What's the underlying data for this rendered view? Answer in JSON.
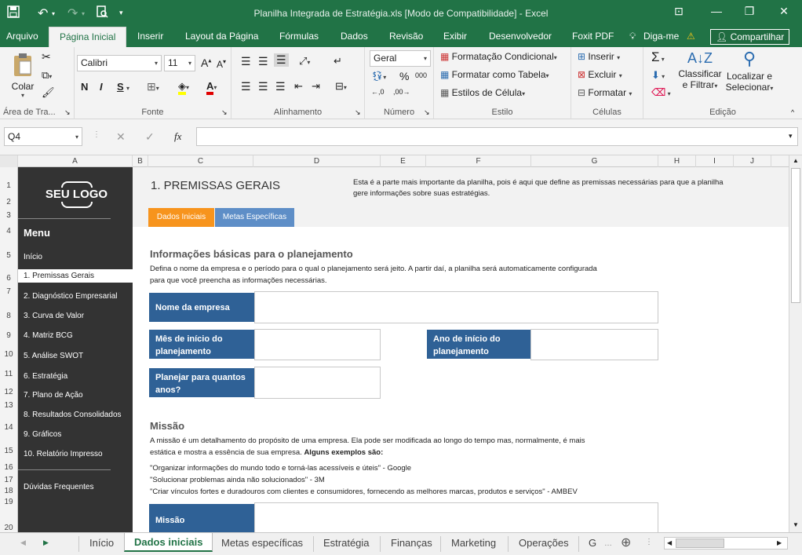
{
  "window": {
    "title": "Planilha Integrada de Estratégia.xls  [Modo de Compatibilidade] - Excel"
  },
  "ribbon_tabs": [
    "Arquivo",
    "Página Inicial",
    "Inserir",
    "Layout da Página",
    "Fórmulas",
    "Dados",
    "Revisão",
    "Exibir",
    "Desenvolvedor",
    "Foxit PDF",
    "Diga-me",
    "Compartilhar"
  ],
  "ribbon": {
    "colar": "Colar",
    "area_transferencia": "Área de Tra...",
    "font_name": "Calibri",
    "font_size": "11",
    "fonte": "Fonte",
    "bold": "N",
    "italic": "I",
    "underline": "S",
    "alinhamento": "Alinhamento",
    "number_format": "Geral",
    "numero": "Número",
    "formatacao_condicional": "Formatação Condicional",
    "formatar_tabela": "Formatar como Tabela",
    "estilos_celula": "Estilos de Célula",
    "estilo": "Estilo",
    "inserir": "Inserir",
    "excluir": "Excluir",
    "formatar": "Formatar",
    "celulas": "Células",
    "classificar_1": "Classificar",
    "classificar_2": "e Filtrar",
    "localizar_1": "Localizar e",
    "localizar_2": "Selecionar",
    "edicao": "Edição"
  },
  "formula_bar": {
    "name_box": "Q4",
    "fx": "fx",
    "formula": ""
  },
  "columns": [
    "A",
    "B",
    "C",
    "D",
    "E",
    "F",
    "G",
    "H",
    "I",
    "J"
  ],
  "rows": [
    "1",
    "2",
    "3",
    "4",
    "5",
    "6",
    "7",
    "8",
    "9",
    "10",
    "11",
    "12",
    "13",
    "14",
    "15",
    "16",
    "17",
    "18",
    "19",
    "20"
  ],
  "sidebar": {
    "logo": "SEU LOGO",
    "menu_title": "Menu",
    "items": [
      "Início",
      "1. Premissas Gerais",
      "2. Diagnóstico Empresarial",
      "3. Curva de Valor",
      "4. Matriz BCG",
      "5. Análise SWOT",
      "6. Estratégia",
      "7. Plano de Ação",
      "8. Resultados Consolidados",
      "9. Gráficos",
      "10. Relatório Impresso",
      "Dúvidas Frequentes"
    ]
  },
  "sheet": {
    "title": "1. PREMISSAS GERAIS",
    "intro_1": "Esta é a parte mais importante da planilha, pois é aqui que  define as premissas necessárias para que  a planilha",
    "intro_2": "gere informações sobre suas estratégias.",
    "tab_1": "Dados Iniciais",
    "tab_2": "Metas Específicas",
    "section_title": "Informações básicas para o planejamento",
    "section_text_1": "Defina o nome da empresa e o período para o qual o planejamento será jeito. A partir daí, a planilha será automaticamente configurada",
    "section_text_2": "para que você preencha as informações necessárias.",
    "field_empresa": "Nome da empresa",
    "field_mes_1": "Mês de início do",
    "field_mes_2": "planejamento",
    "field_ano_1": "Ano de início do",
    "field_ano_2": "planejamento",
    "field_planejar_1": "Planejar para quantos",
    "field_planejar_2": "anos?",
    "missao_title": "Missão",
    "missao_text_1": "A missão é um detalhamento do propósito de uma empresa. Ela pode ser modificada ao longo do tempo mas, normalmente, é mais",
    "missao_text_2a": "estática e mostra a essência de sua empresa. ",
    "missao_text_2b": "Alguns exemplos são:",
    "example_1": "\"Organizar informações do mundo todo e torná-las acessíveis e úteis\" - Google",
    "example_2": "\"Solucionar problemas ainda não solucionados\" - 3M",
    "example_3": "\"Criar vínculos fortes e duradouros com clientes e consumidores, fornecendo as melhores marcas, produtos e serviços\" - AMBEV",
    "field_missao": "Missão"
  },
  "sheet_tabs": [
    "Início",
    "Dados iniciais",
    "Metas específicas",
    "Estratégia",
    "Finanças",
    "Marketing",
    "Operações",
    "G"
  ],
  "colors": {
    "excel_green": "#217346",
    "field_blue": "#2f6196",
    "tab_orange": "#f7941d",
    "tab_blue": "#5e8ec7"
  }
}
